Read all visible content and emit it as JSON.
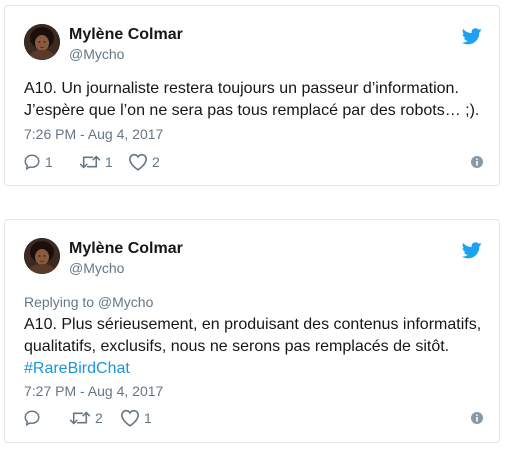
{
  "colors": {
    "text": "#14171a",
    "muted": "#657786",
    "border": "#e1e8ed",
    "brand": "#1da1f2",
    "link": "#1b95e0"
  },
  "tweets": [
    {
      "author_name": "Mylène Colmar",
      "handle": "@Mycho",
      "reply_context": null,
      "text_lines": [
        "A10. Un journaliste restera toujours un passeur d’information.",
        "J’espère que l’on ne sera pas tous remplacé par des robots… ;)."
      ],
      "hashtag": null,
      "timestamp": "7:26 PM - Aug 4, 2017",
      "reply_count": "1",
      "retweet_count": "1",
      "like_count": "2",
      "icons": [
        "twitter-bird-icon",
        "reply-icon",
        "retweet-icon",
        "heart-icon",
        "info-icon"
      ]
    },
    {
      "author_name": "Mylène Colmar",
      "handle": "@Mycho",
      "reply_context": "Replying to @Mycho",
      "text_lines": [
        "A10. Plus sérieusement, en produisant des contenus informatifs,",
        "qualitatifs, exclusifs, nous ne serons pas remplacés de sitôt."
      ],
      "hashtag": "#RareBirdChat",
      "timestamp": "7:27 PM - Aug 4, 2017",
      "reply_count": "",
      "retweet_count": "2",
      "like_count": "1",
      "icons": [
        "twitter-bird-icon",
        "reply-icon",
        "retweet-icon",
        "heart-icon",
        "info-icon"
      ]
    }
  ]
}
